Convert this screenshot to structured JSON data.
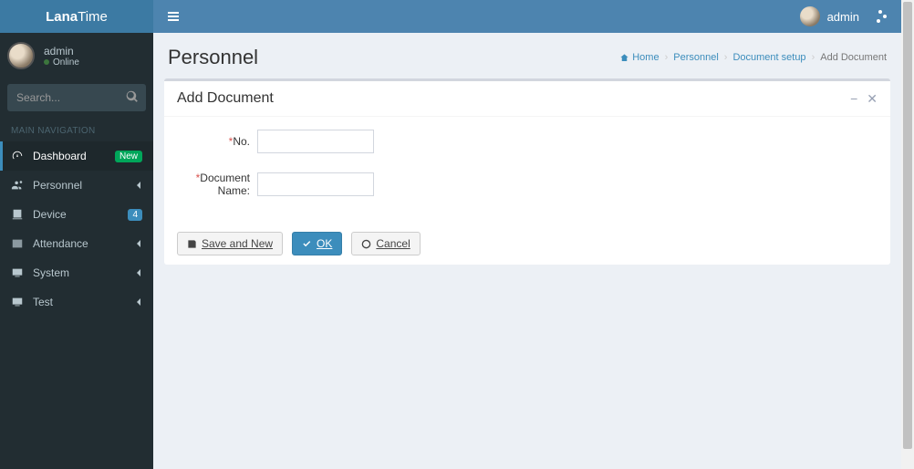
{
  "brand": {
    "bold": "Lana",
    "light": "Time"
  },
  "user_panel": {
    "name": "admin",
    "status": "Online"
  },
  "search": {
    "placeholder": "Search..."
  },
  "nav_header": "MAIN NAVIGATION",
  "nav": {
    "dashboard": {
      "label": "Dashboard",
      "badge": "New"
    },
    "personnel": {
      "label": "Personnel"
    },
    "device": {
      "label": "Device",
      "badge": "4"
    },
    "attendance": {
      "label": "Attendance"
    },
    "system": {
      "label": "System"
    },
    "test": {
      "label": "Test"
    }
  },
  "topbar": {
    "user": "admin"
  },
  "page": {
    "title": "Personnel"
  },
  "breadcrumb": {
    "home": "Home",
    "personnel": "Personnel",
    "docsetup": "Document setup",
    "current": "Add Document"
  },
  "panel": {
    "title": "Add Document",
    "fields": {
      "no_label": "No.",
      "no_value": "",
      "name_label": "Document Name:",
      "name_value": ""
    },
    "buttons": {
      "save_new": "Save and New",
      "ok": "OK",
      "cancel": "Cancel"
    }
  }
}
